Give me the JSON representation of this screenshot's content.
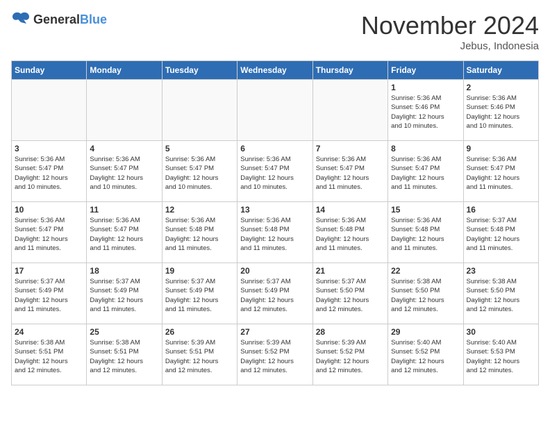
{
  "header": {
    "logo_general": "General",
    "logo_blue": "Blue",
    "month_title": "November 2024",
    "location": "Jebus, Indonesia"
  },
  "days_of_week": [
    "Sunday",
    "Monday",
    "Tuesday",
    "Wednesday",
    "Thursday",
    "Friday",
    "Saturday"
  ],
  "weeks": [
    [
      {
        "day": "",
        "info": ""
      },
      {
        "day": "",
        "info": ""
      },
      {
        "day": "",
        "info": ""
      },
      {
        "day": "",
        "info": ""
      },
      {
        "day": "",
        "info": ""
      },
      {
        "day": "1",
        "info": "Sunrise: 5:36 AM\nSunset: 5:46 PM\nDaylight: 12 hours\nand 10 minutes."
      },
      {
        "day": "2",
        "info": "Sunrise: 5:36 AM\nSunset: 5:46 PM\nDaylight: 12 hours\nand 10 minutes."
      }
    ],
    [
      {
        "day": "3",
        "info": "Sunrise: 5:36 AM\nSunset: 5:47 PM\nDaylight: 12 hours\nand 10 minutes."
      },
      {
        "day": "4",
        "info": "Sunrise: 5:36 AM\nSunset: 5:47 PM\nDaylight: 12 hours\nand 10 minutes."
      },
      {
        "day": "5",
        "info": "Sunrise: 5:36 AM\nSunset: 5:47 PM\nDaylight: 12 hours\nand 10 minutes."
      },
      {
        "day": "6",
        "info": "Sunrise: 5:36 AM\nSunset: 5:47 PM\nDaylight: 12 hours\nand 10 minutes."
      },
      {
        "day": "7",
        "info": "Sunrise: 5:36 AM\nSunset: 5:47 PM\nDaylight: 12 hours\nand 11 minutes."
      },
      {
        "day": "8",
        "info": "Sunrise: 5:36 AM\nSunset: 5:47 PM\nDaylight: 12 hours\nand 11 minutes."
      },
      {
        "day": "9",
        "info": "Sunrise: 5:36 AM\nSunset: 5:47 PM\nDaylight: 12 hours\nand 11 minutes."
      }
    ],
    [
      {
        "day": "10",
        "info": "Sunrise: 5:36 AM\nSunset: 5:47 PM\nDaylight: 12 hours\nand 11 minutes."
      },
      {
        "day": "11",
        "info": "Sunrise: 5:36 AM\nSunset: 5:47 PM\nDaylight: 12 hours\nand 11 minutes."
      },
      {
        "day": "12",
        "info": "Sunrise: 5:36 AM\nSunset: 5:48 PM\nDaylight: 12 hours\nand 11 minutes."
      },
      {
        "day": "13",
        "info": "Sunrise: 5:36 AM\nSunset: 5:48 PM\nDaylight: 12 hours\nand 11 minutes."
      },
      {
        "day": "14",
        "info": "Sunrise: 5:36 AM\nSunset: 5:48 PM\nDaylight: 12 hours\nand 11 minutes."
      },
      {
        "day": "15",
        "info": "Sunrise: 5:36 AM\nSunset: 5:48 PM\nDaylight: 12 hours\nand 11 minutes."
      },
      {
        "day": "16",
        "info": "Sunrise: 5:37 AM\nSunset: 5:48 PM\nDaylight: 12 hours\nand 11 minutes."
      }
    ],
    [
      {
        "day": "17",
        "info": "Sunrise: 5:37 AM\nSunset: 5:49 PM\nDaylight: 12 hours\nand 11 minutes."
      },
      {
        "day": "18",
        "info": "Sunrise: 5:37 AM\nSunset: 5:49 PM\nDaylight: 12 hours\nand 11 minutes."
      },
      {
        "day": "19",
        "info": "Sunrise: 5:37 AM\nSunset: 5:49 PM\nDaylight: 12 hours\nand 11 minutes."
      },
      {
        "day": "20",
        "info": "Sunrise: 5:37 AM\nSunset: 5:49 PM\nDaylight: 12 hours\nand 12 minutes."
      },
      {
        "day": "21",
        "info": "Sunrise: 5:37 AM\nSunset: 5:50 PM\nDaylight: 12 hours\nand 12 minutes."
      },
      {
        "day": "22",
        "info": "Sunrise: 5:38 AM\nSunset: 5:50 PM\nDaylight: 12 hours\nand 12 minutes."
      },
      {
        "day": "23",
        "info": "Sunrise: 5:38 AM\nSunset: 5:50 PM\nDaylight: 12 hours\nand 12 minutes."
      }
    ],
    [
      {
        "day": "24",
        "info": "Sunrise: 5:38 AM\nSunset: 5:51 PM\nDaylight: 12 hours\nand 12 minutes."
      },
      {
        "day": "25",
        "info": "Sunrise: 5:38 AM\nSunset: 5:51 PM\nDaylight: 12 hours\nand 12 minutes."
      },
      {
        "day": "26",
        "info": "Sunrise: 5:39 AM\nSunset: 5:51 PM\nDaylight: 12 hours\nand 12 minutes."
      },
      {
        "day": "27",
        "info": "Sunrise: 5:39 AM\nSunset: 5:52 PM\nDaylight: 12 hours\nand 12 minutes."
      },
      {
        "day": "28",
        "info": "Sunrise: 5:39 AM\nSunset: 5:52 PM\nDaylight: 12 hours\nand 12 minutes."
      },
      {
        "day": "29",
        "info": "Sunrise: 5:40 AM\nSunset: 5:52 PM\nDaylight: 12 hours\nand 12 minutes."
      },
      {
        "day": "30",
        "info": "Sunrise: 5:40 AM\nSunset: 5:53 PM\nDaylight: 12 hours\nand 12 minutes."
      }
    ]
  ]
}
